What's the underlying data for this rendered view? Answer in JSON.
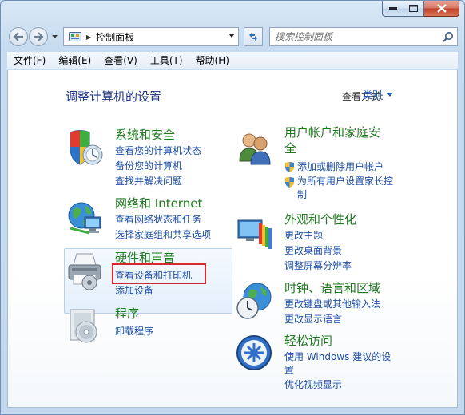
{
  "address": {
    "crumb": "控制面板"
  },
  "search": {
    "placeholder": "搜索控制面板"
  },
  "menu": [
    "文件(F)",
    "编辑(E)",
    "查看(V)",
    "工具(T)",
    "帮助(H)"
  ],
  "page": {
    "title": "调整计算机的设置",
    "view_by_label": "查看方式:",
    "view_by_value": "类别"
  },
  "left_categories": [
    {
      "title": "系统和安全",
      "icon": "shield-icon",
      "links": [
        "查看您的计算机状态",
        "备份您的计算机",
        "查找并解决问题"
      ]
    },
    {
      "title": "网络和 Internet",
      "icon": "network-icon",
      "links": [
        "查看网络状态和任务",
        "选择家庭组和共享选项"
      ]
    },
    {
      "title": "硬件和声音",
      "icon": "printer-icon",
      "links": [
        "查看设备和打印机",
        "添加设备"
      ]
    },
    {
      "title": "程序",
      "icon": "programs-icon",
      "links": [
        "卸载程序"
      ]
    }
  ],
  "right_categories": [
    {
      "title": "用户帐户和家庭安全",
      "icon": "users-icon",
      "links": [
        "添加或删除用户帐户",
        "为所有用户设置家长控制"
      ]
    },
    {
      "title": "外观和个性化",
      "icon": "appearance-icon",
      "links": [
        "更改主题",
        "更改桌面背景",
        "调整屏幕分辨率"
      ]
    },
    {
      "title": "时钟、语言和区域",
      "icon": "clock-globe-icon",
      "links": [
        "更改键盘或其他输入法",
        "更改显示语言"
      ]
    },
    {
      "title": "轻松访问",
      "icon": "ease-of-access-icon",
      "links": [
        "使用 Windows 建议的设置",
        "优化视频显示"
      ]
    }
  ],
  "colors": {
    "title_green": "#1e7a1e",
    "link_blue": "#1e4fa8",
    "heading_blue": "#1e3287",
    "highlight_red": "#d6282e"
  }
}
